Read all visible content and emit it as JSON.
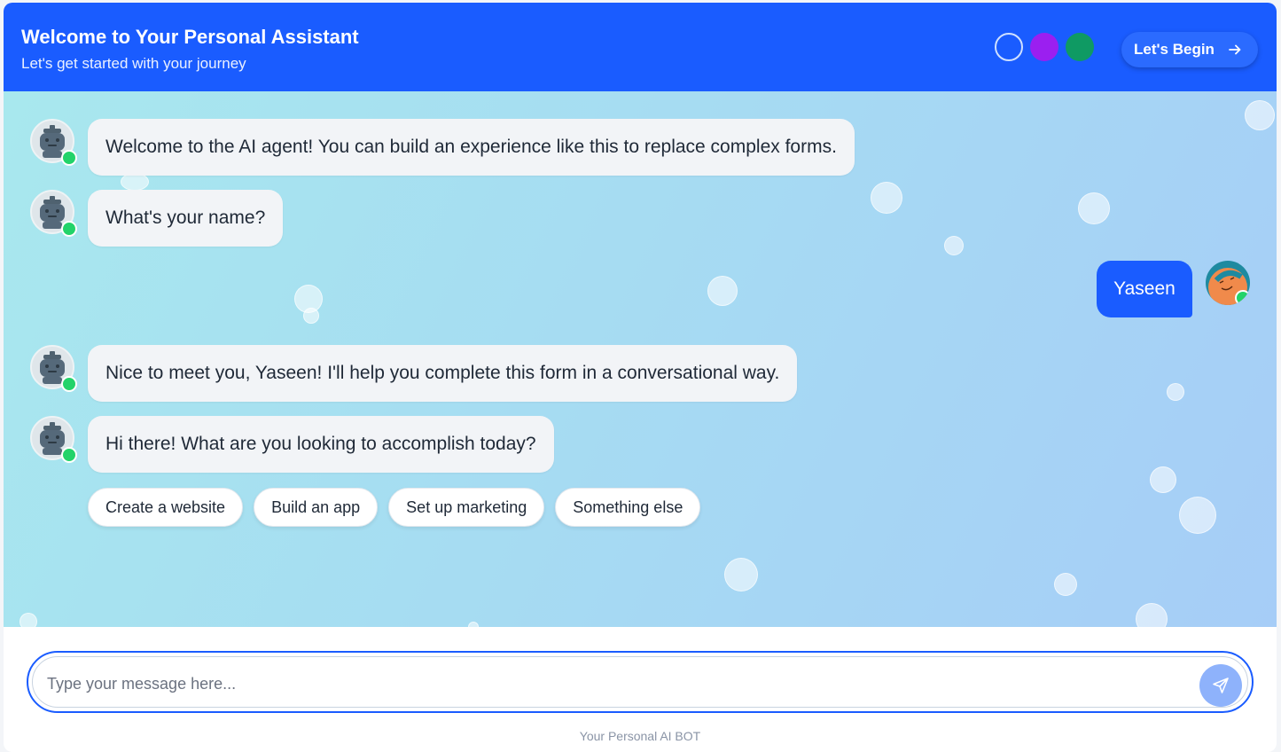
{
  "header": {
    "title": "Welcome to Your Personal Assistant",
    "subtitle": "Let's get started with your journey",
    "begin_label": "Let's Begin",
    "theme_dots": [
      "#1a5cff",
      "#9b1ff0",
      "#0f9a63"
    ]
  },
  "chat": {
    "messages": [
      {
        "sender": "bot",
        "text": "Welcome to the AI agent! You can build an experience like this to replace complex forms."
      },
      {
        "sender": "bot",
        "text": "What's your name?"
      },
      {
        "sender": "user",
        "text": "Yaseen"
      },
      {
        "sender": "bot",
        "text": "Nice to meet you, Yaseen! I'll help you complete this form in a conversational way."
      },
      {
        "sender": "bot",
        "text": "Hi there! What are you looking to accomplish today?"
      }
    ],
    "options": [
      "Create a website",
      "Build an app",
      "Set up marketing",
      "Something else"
    ]
  },
  "input": {
    "placeholder": "Type your message here...",
    "value": ""
  },
  "footer": {
    "text": "Your Personal AI BOT"
  },
  "colors": {
    "primary": "#1a5cff",
    "online": "#22d36a",
    "bot_bubble": "#f2f4f7"
  },
  "icons": [
    "arrow-right-icon",
    "robot-icon",
    "user-avatar-icon",
    "send-icon"
  ]
}
